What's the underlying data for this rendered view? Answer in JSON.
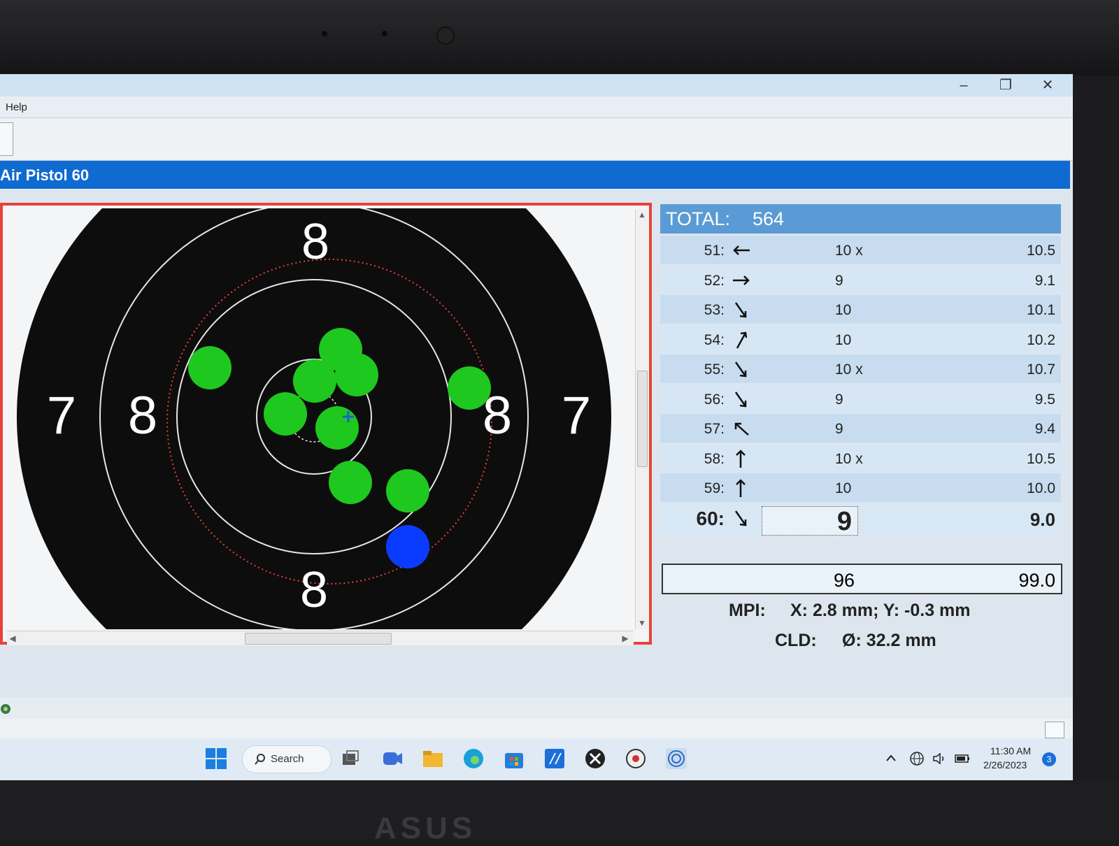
{
  "app": {
    "menu": [
      "Help"
    ],
    "header_title": "Air Pistol 60"
  },
  "target": {
    "ring_labels": {
      "top": "8",
      "bottom": "8",
      "left_outer": "7",
      "left_inner": "8",
      "right_inner": "8",
      "right_outer": "7"
    },
    "colors": {
      "shot_green": "#1ec81e",
      "last_shot_blue": "#0a3cff",
      "frame_red": "#e8423a",
      "mpi_marker": "#1d5fd1"
    }
  },
  "results": {
    "total_label": "TOTAL:",
    "total_value": "564",
    "shots": [
      {
        "num": "51:",
        "dir": "W",
        "score": "10 x",
        "decimal": "10.5"
      },
      {
        "num": "52:",
        "dir": "E",
        "score": "9",
        "decimal": "9.1"
      },
      {
        "num": "53:",
        "dir": "SE",
        "score": "10",
        "decimal": "10.1"
      },
      {
        "num": "54:",
        "dir": "NE",
        "score": "10",
        "decimal": "10.2"
      },
      {
        "num": "55:",
        "dir": "SE",
        "score": "10 x",
        "decimal": "10.7"
      },
      {
        "num": "56:",
        "dir": "SE",
        "score": "9",
        "decimal": "9.5"
      },
      {
        "num": "57:",
        "dir": "NW",
        "score": "9",
        "decimal": "9.4"
      },
      {
        "num": "58:",
        "dir": "N",
        "score": "10 x",
        "decimal": "10.5"
      },
      {
        "num": "59:",
        "dir": "N",
        "score": "10",
        "decimal": "10.0"
      },
      {
        "num": "60:",
        "dir": "SE",
        "score": "9",
        "decimal": "9.0"
      }
    ],
    "series_sum": "96",
    "series_decimal_sum": "99.0",
    "mpi_label": "MPI:",
    "mpi_value": "X: 2.8 mm; Y: -0.3 mm",
    "cld_label": "CLD:",
    "cld_value": "Ø: 32.2 mm"
  },
  "taskbar": {
    "search_label": "Search",
    "time": "11:30 AM",
    "date": "2/26/2023",
    "notification_count": "3"
  }
}
